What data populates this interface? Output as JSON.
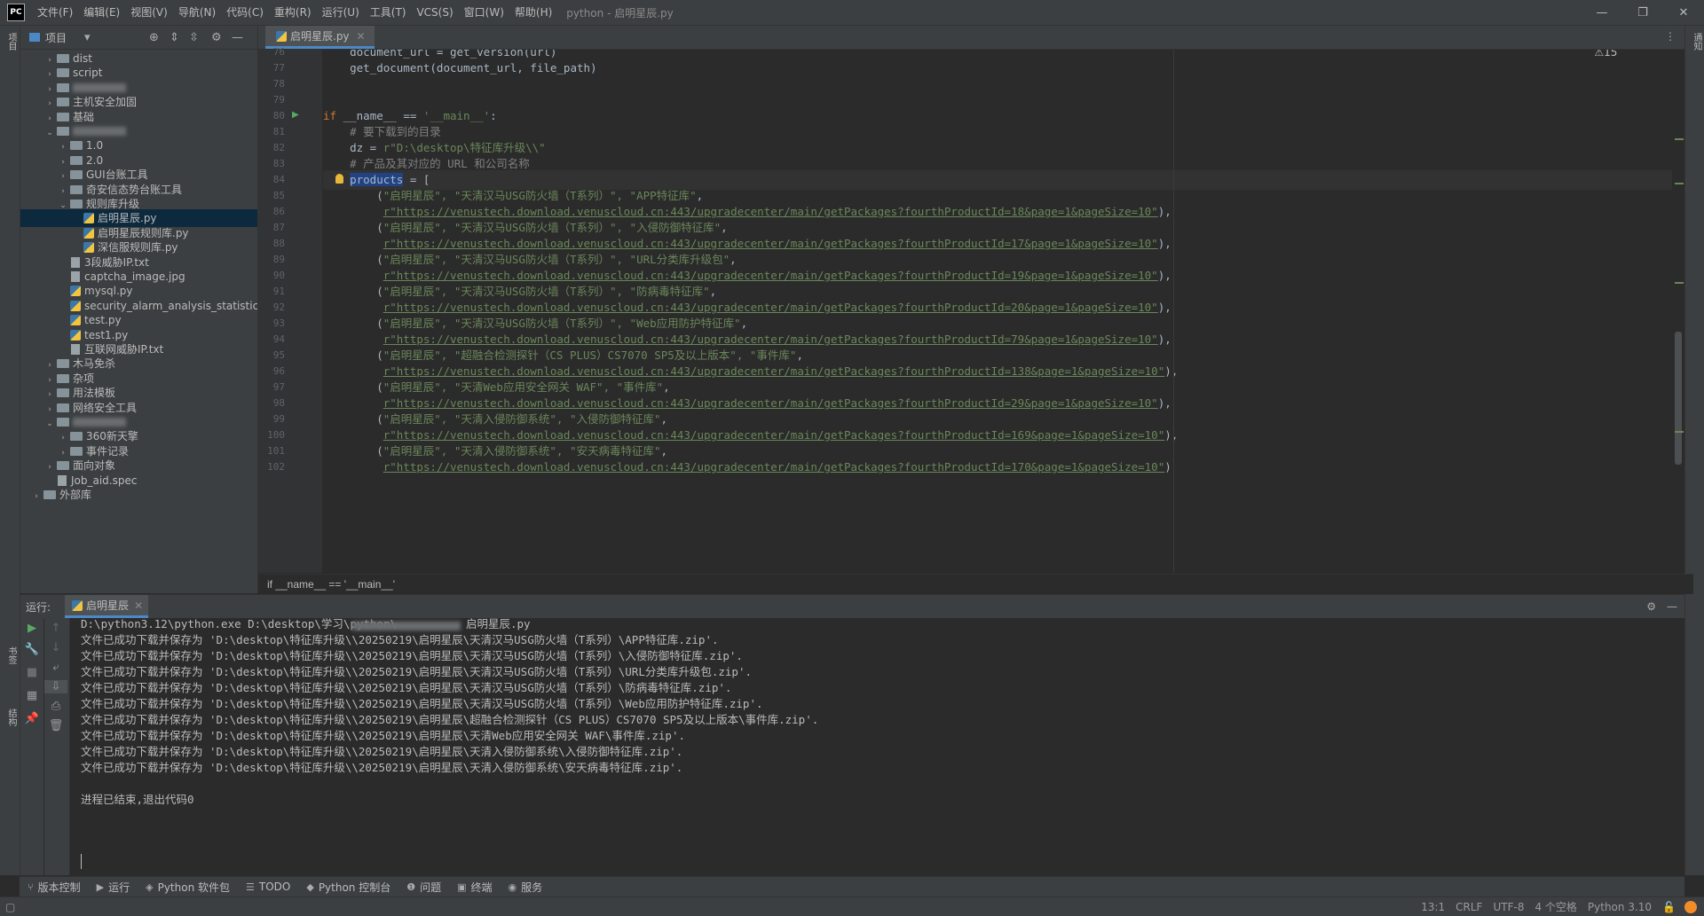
{
  "app": {
    "logo": "PC",
    "window_title": "python - 启明星辰.py"
  },
  "menu": [
    "文件(F)",
    "编辑(E)",
    "视图(V)",
    "导航(N)",
    "代码(C)",
    "重构(R)",
    "运行(U)",
    "工具(T)",
    "VCS(S)",
    "窗口(W)",
    "帮助(H)"
  ],
  "window_controls": {
    "minimize": "—",
    "restore": "❐",
    "close": "✕"
  },
  "left_strip": {
    "project_tab": "项目",
    "bookmarks_tab": "书签",
    "structure_tab": "结构"
  },
  "right_strip": {
    "notifications_tab": "通知"
  },
  "project": {
    "header_label": "项目",
    "tree": [
      {
        "label": "dist",
        "type": "folder",
        "depth": 1,
        "arrow": "›"
      },
      {
        "label": "script",
        "type": "folder",
        "depth": 1,
        "arrow": "›"
      },
      {
        "label": "",
        "type": "folder-blur",
        "depth": 1,
        "arrow": "›"
      },
      {
        "label": "主机安全加固",
        "type": "folder",
        "depth": 1,
        "arrow": "›"
      },
      {
        "label": "基础",
        "type": "folder",
        "depth": 1,
        "arrow": "›"
      },
      {
        "label": "",
        "type": "folder-blur",
        "depth": 1,
        "arrow": "⌄"
      },
      {
        "label": "1.0",
        "type": "folder",
        "depth": 2,
        "arrow": "›"
      },
      {
        "label": "2.0",
        "type": "folder",
        "depth": 2,
        "arrow": "›"
      },
      {
        "label": "GUI台账工具",
        "type": "folder",
        "depth": 2,
        "arrow": "›"
      },
      {
        "label": "奇安信态势台账工具",
        "type": "folder",
        "depth": 2,
        "arrow": "›"
      },
      {
        "label": "规则库升级",
        "type": "folder",
        "depth": 2,
        "arrow": "⌄"
      },
      {
        "label": "启明星辰.py",
        "type": "py",
        "depth": 3,
        "arrow": "",
        "selected": true
      },
      {
        "label": "启明星辰规则库.py",
        "type": "py",
        "depth": 3,
        "arrow": ""
      },
      {
        "label": "深信服规则库.py",
        "type": "py",
        "depth": 3,
        "arrow": ""
      },
      {
        "label": "3段威胁IP.txt",
        "type": "file",
        "depth": 2,
        "arrow": ""
      },
      {
        "label": "captcha_image.jpg",
        "type": "file",
        "depth": 2,
        "arrow": ""
      },
      {
        "label": "mysql.py",
        "type": "py",
        "depth": 2,
        "arrow": ""
      },
      {
        "label": "security_alarm_analysis_statistics_",
        "type": "py",
        "depth": 2,
        "arrow": ""
      },
      {
        "label": "test.py",
        "type": "py",
        "depth": 2,
        "arrow": ""
      },
      {
        "label": "test1.py",
        "type": "py",
        "depth": 2,
        "arrow": ""
      },
      {
        "label": "互联网威胁IP.txt",
        "type": "file",
        "depth": 2,
        "arrow": ""
      },
      {
        "label": "木马免杀",
        "type": "folder",
        "depth": 1,
        "arrow": "›"
      },
      {
        "label": "杂项",
        "type": "folder",
        "depth": 1,
        "arrow": "›"
      },
      {
        "label": "用法模板",
        "type": "folder",
        "depth": 1,
        "arrow": "›"
      },
      {
        "label": "网络安全工具",
        "type": "folder",
        "depth": 1,
        "arrow": "›"
      },
      {
        "label": "",
        "type": "folder-blur",
        "depth": 1,
        "arrow": "⌄"
      },
      {
        "label": "360新天擎",
        "type": "folder",
        "depth": 2,
        "arrow": "›"
      },
      {
        "label": "事件记录",
        "type": "folder",
        "depth": 2,
        "arrow": "›"
      },
      {
        "label": "面向对象",
        "type": "folder",
        "depth": 1,
        "arrow": "›"
      },
      {
        "label": "Job_aid.spec",
        "type": "file",
        "depth": 1,
        "arrow": ""
      },
      {
        "label": "外部库",
        "type": "lib",
        "depth": 0,
        "arrow": "›"
      }
    ]
  },
  "editor": {
    "tab_label": "启明星辰.py",
    "warnings": "⚠15",
    "breadcrumb": "if __name__ == '__main__'",
    "lines": [
      {
        "no": "76",
        "html": "    document_url = get_version(url)"
      },
      {
        "no": "77",
        "html": "    get_document(document_url, file_path)"
      },
      {
        "no": "78",
        "html": ""
      },
      {
        "no": "79",
        "html": ""
      },
      {
        "no": "80",
        "kw": "if",
        "rest": " __name__ == ",
        "str": "'__main__'",
        "tail": ":"
      },
      {
        "no": "81",
        "cmt": "    # 要下载到的目录"
      },
      {
        "no": "82",
        "pre": "    dz = ",
        "str": "r\"D:\\desktop\\特征库升级\\\\\""
      },
      {
        "no": "83",
        "cmt": "    # 产品及其对应的 URL 和公司名称"
      },
      {
        "no": "84",
        "pre": "    ",
        "sel": "products",
        "tail": " = ["
      },
      {
        "no": "85",
        "pre": "        (",
        "str": "\"启明星辰\", \"天清汉马USG防火墙（T系列）\", \"APP特征库\"",
        "tail": ","
      },
      {
        "no": "86",
        "pre": "         ",
        "url": "r\"https://venustech.download.venuscloud.cn:443/upgradecenter/main/getPackages?fourthProductId=18&page=1&pageSize=10\"",
        "tail": "),"
      },
      {
        "no": "87",
        "pre": "        (",
        "str": "\"启明星辰\", \"天清汉马USG防火墙（T系列）\", \"入侵防御特征库\"",
        "tail": ","
      },
      {
        "no": "88",
        "pre": "         ",
        "url": "r\"https://venustech.download.venuscloud.cn:443/upgradecenter/main/getPackages?fourthProductId=17&page=1&pageSize=10\"",
        "tail": "),"
      },
      {
        "no": "89",
        "pre": "        (",
        "str": "\"启明星辰\", \"天清汉马USG防火墙（T系列）\", \"URL分类库升级包\"",
        "tail": ","
      },
      {
        "no": "90",
        "pre": "         ",
        "url": "r\"https://venustech.download.venuscloud.cn:443/upgradecenter/main/getPackages?fourthProductId=19&page=1&pageSize=10\"",
        "tail": "),"
      },
      {
        "no": "91",
        "pre": "        (",
        "str": "\"启明星辰\", \"天清汉马USG防火墙（T系列）\", \"防病毒特征库\"",
        "tail": ","
      },
      {
        "no": "92",
        "pre": "         ",
        "url": "r\"https://venustech.download.venuscloud.cn:443/upgradecenter/main/getPackages?fourthProductId=20&page=1&pageSize=10\"",
        "tail": "),"
      },
      {
        "no": "93",
        "pre": "        (",
        "str": "\"启明星辰\", \"天清汉马USG防火墙（T系列）\", \"Web应用防护特征库\"",
        "tail": ","
      },
      {
        "no": "94",
        "pre": "         ",
        "url": "r\"https://venustech.download.venuscloud.cn:443/upgradecenter/main/getPackages?fourthProductId=79&page=1&pageSize=10\"",
        "tail": "),"
      },
      {
        "no": "95",
        "pre": "        (",
        "str": "\"启明星辰\", \"超融合检测探针（CS PLUS）CS7070 SP5及以上版本\", \"事件库\"",
        "tail": ","
      },
      {
        "no": "96",
        "pre": "         ",
        "url": "r\"https://venustech.download.venuscloud.cn:443/upgradecenter/main/getPackages?fourthProductId=138&page=1&pageSize=10\"",
        "tail": "),"
      },
      {
        "no": "97",
        "pre": "        (",
        "str": "\"启明星辰\", \"天清Web应用安全网关 WAF\", \"事件库\"",
        "tail": ","
      },
      {
        "no": "98",
        "pre": "         ",
        "url": "r\"https://venustech.download.venuscloud.cn:443/upgradecenter/main/getPackages?fourthProductId=29&page=1&pageSize=10\"",
        "tail": "),"
      },
      {
        "no": "99",
        "pre": "        (",
        "str": "\"启明星辰\", \"天清入侵防御系统\", \"入侵防御特征库\"",
        "tail": ","
      },
      {
        "no": "100",
        "pre": "         ",
        "url": "r\"https://venustech.download.venuscloud.cn:443/upgradecenter/main/getPackages?fourthProductId=169&page=1&pageSize=10\"",
        "tail": "),"
      },
      {
        "no": "101",
        "pre": "        (",
        "str": "\"启明星辰\", \"天清入侵防御系统\", \"安天病毒特征库\"",
        "tail": ","
      },
      {
        "no": "102",
        "pre": "         ",
        "url": "r\"https://venustech.download.venuscloud.cn:443/upgradecenter/main/getPackages?fourthProductId=170&page=1&pageSize=10\"",
        "tail": ")"
      }
    ]
  },
  "run": {
    "label": "运行:",
    "tab_label": "启明星辰",
    "console": [
      "D:\\python3.12\\python.exe D:\\desktop\\学习\\python\\",
      "文件已成功下载并保存为 'D:\\desktop\\特征库升级\\\\20250219\\启明星辰\\天清汉马USG防火墙（T系列）\\APP特征库.zip'.",
      "文件已成功下载并保存为 'D:\\desktop\\特征库升级\\\\20250219\\启明星辰\\天清汉马USG防火墙（T系列）\\入侵防御特征库.zip'.",
      "文件已成功下载并保存为 'D:\\desktop\\特征库升级\\\\20250219\\启明星辰\\天清汉马USG防火墙（T系列）\\URL分类库升级包.zip'.",
      "文件已成功下载并保存为 'D:\\desktop\\特征库升级\\\\20250219\\启明星辰\\天清汉马USG防火墙（T系列）\\防病毒特征库.zip'.",
      "文件已成功下载并保存为 'D:\\desktop\\特征库升级\\\\20250219\\启明星辰\\天清汉马USG防火墙（T系列）\\Web应用防护特征库.zip'.",
      "文件已成功下载并保存为 'D:\\desktop\\特征库升级\\\\20250219\\启明星辰\\超融合检测探针（CS PLUS）CS7070 SP5及以上版本\\事件库.zip'.",
      "文件已成功下载并保存为 'D:\\desktop\\特征库升级\\\\20250219\\启明星辰\\天清Web应用安全网关 WAF\\事件库.zip'.",
      "文件已成功下载并保存为 'D:\\desktop\\特征库升级\\\\20250219\\启明星辰\\天清入侵防御系统\\入侵防御特征库.zip'.",
      "文件已成功下载并保存为 'D:\\desktop\\特征库升级\\\\20250219\\启明星辰\\天清入侵防御系统\\安天病毒特征库.zip'.",
      "",
      "进程已结束,退出代码0"
    ],
    "console_first_tail": "启明星辰.py"
  },
  "bottom_tools": [
    {
      "icon": "⑂",
      "label": "版本控制"
    },
    {
      "icon": "▶",
      "label": "运行"
    },
    {
      "icon": "◈",
      "label": "Python 软件包"
    },
    {
      "icon": "☰",
      "label": "TODO"
    },
    {
      "icon": "◆",
      "label": "Python 控制台"
    },
    {
      "icon": "❶",
      "label": "问题"
    },
    {
      "icon": "▣",
      "label": "终端"
    },
    {
      "icon": "◉",
      "label": "服务"
    }
  ],
  "status": {
    "position": "13:1",
    "line_sep": "CRLF",
    "encoding": "UTF-8",
    "indent": "4 个空格",
    "interpreter": "Python 3.10"
  }
}
